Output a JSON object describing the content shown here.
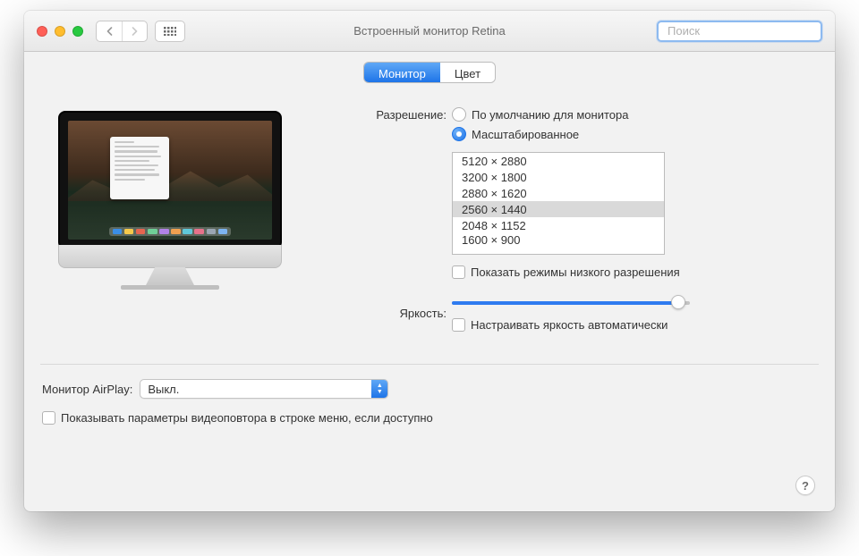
{
  "window": {
    "title": "Встроенный монитор Retina"
  },
  "search": {
    "placeholder": "Поиск"
  },
  "tabs": {
    "monitor": "Монитор",
    "color": "Цвет"
  },
  "labels": {
    "resolution": "Разрешение:",
    "brightness": "Яркость:",
    "airplay": "Монитор AirPlay:"
  },
  "resolution": {
    "default_option": "По умолчанию для монитора",
    "scaled_option": "Масштабированное",
    "selected_mode": "scaled",
    "list": [
      "5120 × 2880",
      "3200 × 1800",
      "2880 × 1620",
      "2560 × 1440",
      "2048 × 1152",
      "1600 × 900"
    ],
    "selected_index": 3,
    "show_low_res_label": "Показать режимы низкого разрешения",
    "show_low_res_checked": false
  },
  "brightness": {
    "percent": 95,
    "auto_label": "Настраивать яркость автоматически",
    "auto_checked": false
  },
  "airplay": {
    "value": "Выкл."
  },
  "mirroring": {
    "label": "Показывать параметры видеоповтора в строке меню, если доступно",
    "checked": false
  },
  "help": "?",
  "dock_colors": [
    "#3a8ee6",
    "#f4c94b",
    "#e66550",
    "#6fcf97",
    "#b182e6",
    "#f0a050",
    "#5fc8d8",
    "#e6728a",
    "#9aa6b2",
    "#7db4f0"
  ]
}
